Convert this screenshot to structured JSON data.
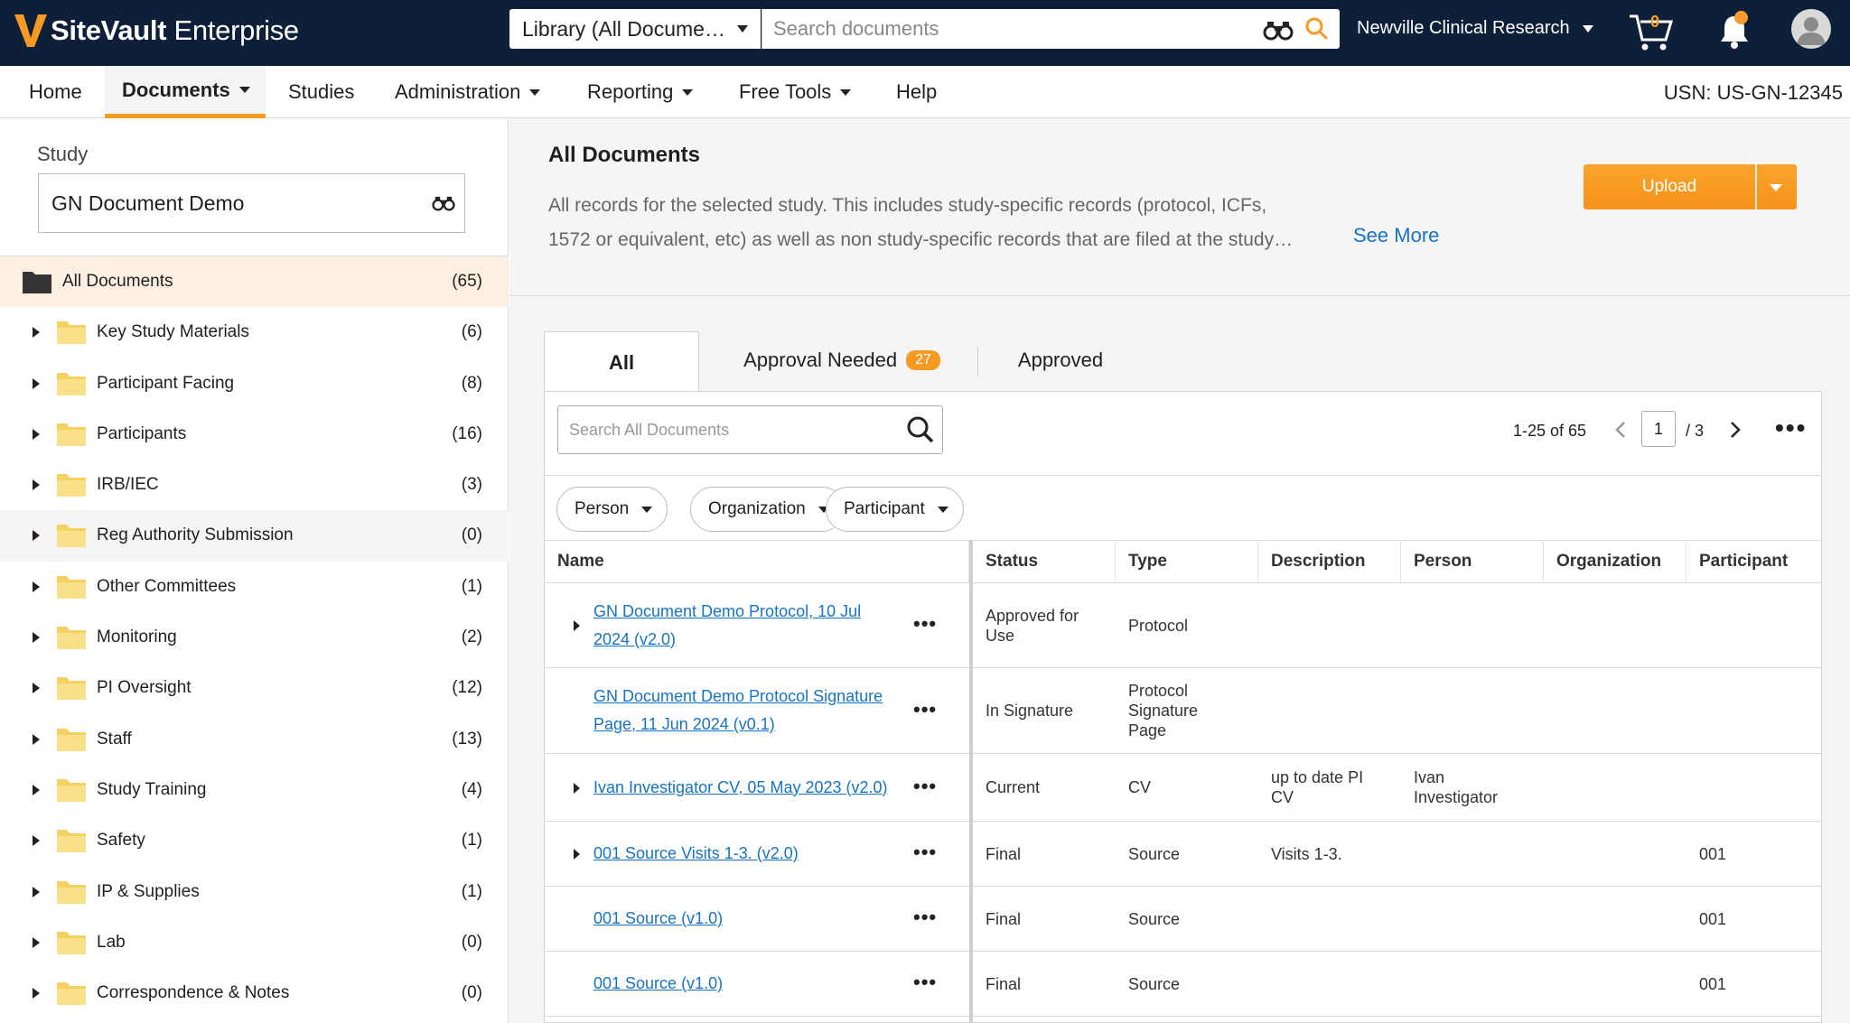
{
  "app": {
    "logo_main": "SiteVault",
    "logo_sub": " Enterprise",
    "library_select": "Library (All Docume…",
    "global_search_placeholder": "Search documents",
    "org_name": "Newville Clinical Research",
    "cart_count": "0",
    "accent": "#f59a23",
    "brand_dark": "#0e1f3a"
  },
  "nav": {
    "items": [
      {
        "label": "Home"
      },
      {
        "label": "Documents"
      },
      {
        "label": "Studies"
      },
      {
        "label": "Administration"
      },
      {
        "label": "Reporting"
      },
      {
        "label": "Free Tools"
      },
      {
        "label": "Help"
      }
    ],
    "usn": "USN: US-GN-12345"
  },
  "sidebar": {
    "study_label": "Study",
    "study_value": "GN Document Demo",
    "root": {
      "label": "All Documents",
      "count": "(65)"
    },
    "folders": [
      {
        "label": "Key Study Materials",
        "count": "(6)"
      },
      {
        "label": "Participant Facing",
        "count": "(8)"
      },
      {
        "label": "Participants",
        "count": "(16)"
      },
      {
        "label": "IRB/IEC",
        "count": "(3)"
      },
      {
        "label": "Reg Authority Submission",
        "count": "(0)"
      },
      {
        "label": "Other Committees",
        "count": "(1)"
      },
      {
        "label": "Monitoring",
        "count": "(2)"
      },
      {
        "label": "PI Oversight",
        "count": "(12)"
      },
      {
        "label": "Staff",
        "count": "(13)"
      },
      {
        "label": "Study Training",
        "count": "(4)"
      },
      {
        "label": "Safety",
        "count": "(1)"
      },
      {
        "label": "IP & Supplies",
        "count": "(1)"
      },
      {
        "label": "Lab",
        "count": "(0)"
      },
      {
        "label": "Correspondence & Notes",
        "count": "(0)"
      }
    ]
  },
  "main": {
    "title": "All Documents",
    "desc_line1": "All records for the selected study. This includes study-specific records (protocol, ICFs,",
    "desc_line2": "1572 or equivalent, etc) as well as non study-specific records that are filed at the study…",
    "see_more": "See More",
    "upload": "Upload",
    "tabs": {
      "all": "All",
      "approval_needed": "Approval Needed",
      "approval_count": "27",
      "approved": "Approved"
    },
    "doc_search_placeholder": "Search All Documents",
    "pager": {
      "range": "1-25 of 65",
      "page": "1",
      "of": "/ 3"
    },
    "filters": {
      "person": "Person",
      "organization": "Organization",
      "participant": "Participant"
    },
    "columns": {
      "name": "Name",
      "status": "Status",
      "type": "Type",
      "description": "Description",
      "person": "Person",
      "organization": "Organization",
      "participant": "Participant"
    },
    "rows": [
      {
        "name_l1": "GN Document Demo Protocol, 10 Jul",
        "name_l2": "2024 (v2.0)",
        "status_l1": "Approved for",
        "status_l2": "Use",
        "type_l1": "Protocol",
        "type_l2": "",
        "type_l3": "",
        "desc_l1": "",
        "desc_l2": "",
        "person_l1": "",
        "person_l2": "",
        "participant": ""
      },
      {
        "name_l1": "GN Document Demo Protocol Signature",
        "name_l2": "Page, 11 Jun 2024 (v0.1)",
        "status_l1": "In Signature",
        "status_l2": "",
        "type_l1": "Protocol",
        "type_l2": "Signature",
        "type_l3": "Page",
        "desc_l1": "",
        "desc_l2": "",
        "person_l1": "",
        "person_l2": "",
        "participant": ""
      },
      {
        "name_l1": "Ivan Investigator CV, 05 May 2023 (v2.0)",
        "name_l2": "",
        "status_l1": "Current",
        "status_l2": "",
        "type_l1": "CV",
        "type_l2": "",
        "type_l3": "",
        "desc_l1": "up to date PI",
        "desc_l2": "CV",
        "person_l1": "Ivan",
        "person_l2": "Investigator",
        "participant": ""
      },
      {
        "name_l1": "001 Source Visits 1-3. (v2.0)",
        "name_l2": "",
        "status_l1": "Final",
        "status_l2": "",
        "type_l1": "Source",
        "type_l2": "",
        "type_l3": "",
        "desc_l1": "Visits 1-3.",
        "desc_l2": "",
        "person_l1": "",
        "person_l2": "",
        "participant": "001"
      },
      {
        "name_l1": "001 Source (v1.0)",
        "name_l2": "",
        "status_l1": "Final",
        "status_l2": "",
        "type_l1": "Source",
        "type_l2": "",
        "type_l3": "",
        "desc_l1": "",
        "desc_l2": "",
        "person_l1": "",
        "person_l2": "",
        "participant": "001"
      },
      {
        "name_l1": "001 Source (v1.0)",
        "name_l2": "",
        "status_l1": "Final",
        "status_l2": "",
        "type_l1": "Source",
        "type_l2": "",
        "type_l3": "",
        "desc_l1": "",
        "desc_l2": "",
        "person_l1": "",
        "person_l2": "",
        "participant": "001"
      }
    ]
  }
}
